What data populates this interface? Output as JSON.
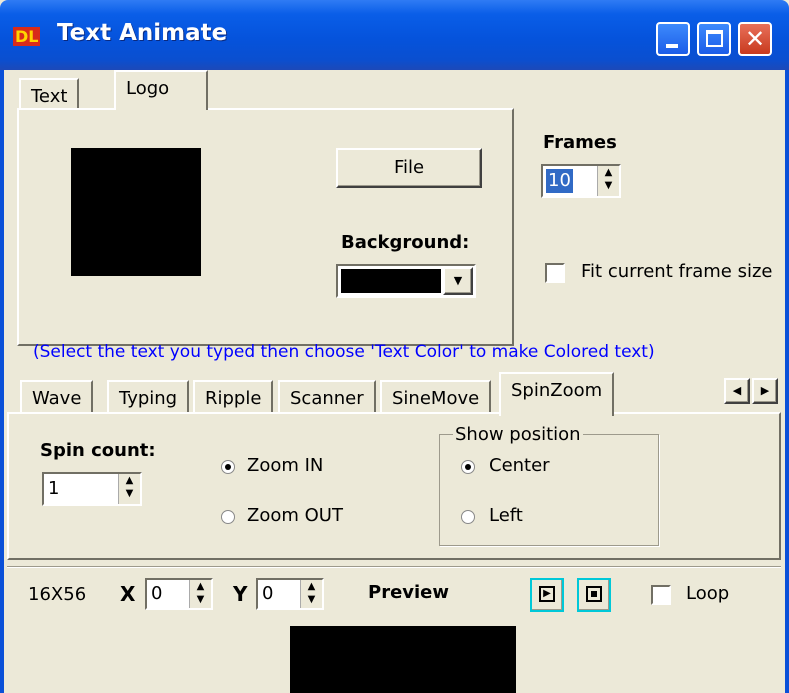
{
  "window": {
    "title": "Text Animate",
    "app_icon_text": "DL"
  },
  "top_tabs": [
    "Text",
    "Logo"
  ],
  "logo_panel": {
    "file_button": "File",
    "background_label": "Background:",
    "background_color": "#000000"
  },
  "frames": {
    "label": "Frames",
    "value": "10",
    "fit_label": "Fit current frame size"
  },
  "hint": "(Select the text you typed then choose 'Text Color' to make Colored text)",
  "effect_tabs": [
    "Wave",
    "Typing",
    "Ripple",
    "Scanner",
    "SineMove",
    "SpinZoom"
  ],
  "spinzoom": {
    "spin_count_label": "Spin count:",
    "spin_count_value": "1",
    "zoom_in": "Zoom IN",
    "zoom_out": "Zoom OUT",
    "show_position_label": "Show position",
    "center": "Center",
    "left": "Left"
  },
  "bottom": {
    "size": "16X56",
    "x_label": "X",
    "x_value": "0",
    "y_label": "Y",
    "y_value": "0",
    "preview_label": "Preview",
    "loop_label": "Loop"
  },
  "colors": {
    "accent": "#0a50d8",
    "hint": "#0000ff",
    "close": "#d9492b"
  }
}
